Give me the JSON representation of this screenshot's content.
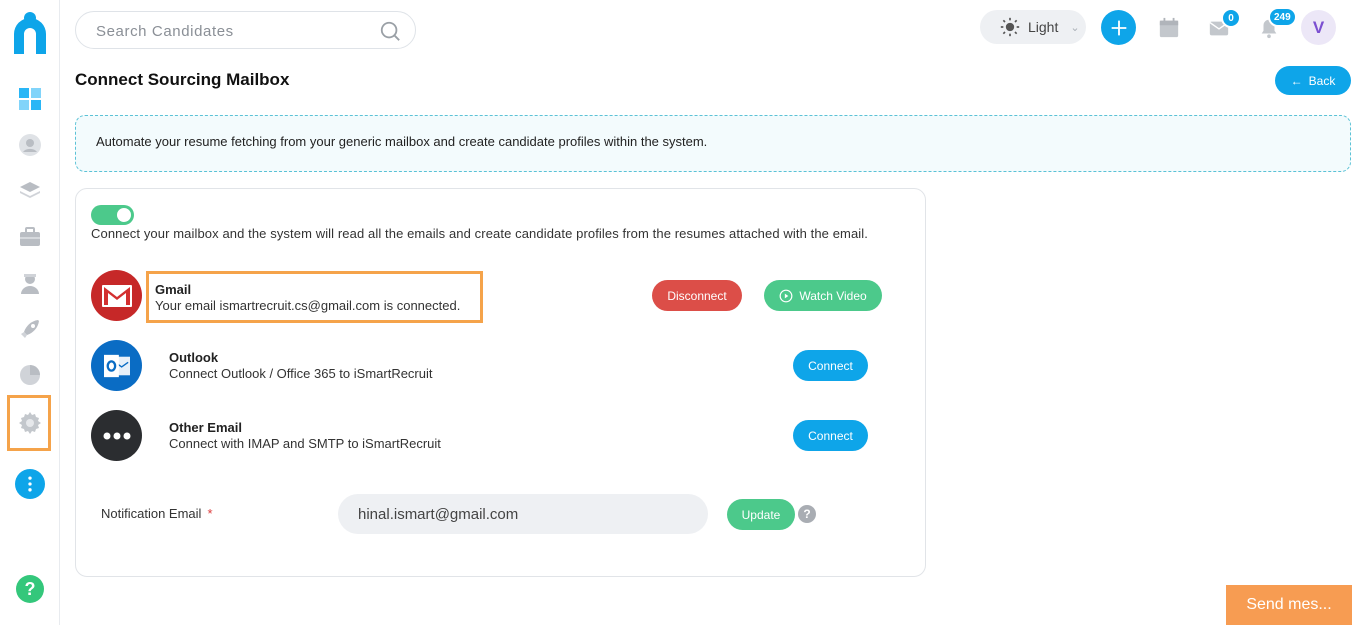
{
  "search": {
    "placeholder": "Search Candidates"
  },
  "header": {
    "theme_label": "Light",
    "mail_count": "0",
    "notification_count": "249",
    "avatar_initial": "V"
  },
  "page": {
    "title": "Connect Sourcing Mailbox",
    "back_label": "Back",
    "info_text": "Automate your resume fetching from your generic mailbox and create candidate profiles within the system."
  },
  "card": {
    "description": "Connect your mailbox and the system will read all the emails and create candidate profiles from the resumes attached with the email.",
    "providers": [
      {
        "name": "Gmail",
        "subtitle": "Your email ismartrecruit.cs@gmail.com is connected.",
        "icon": "gmail-icon"
      },
      {
        "name": "Outlook",
        "subtitle": "Connect Outlook / Office 365 to iSmartRecruit",
        "icon": "outlook-icon"
      },
      {
        "name": "Other Email",
        "subtitle": "Connect with IMAP and SMTP to iSmartRecruit",
        "icon": "more-horizontal-icon"
      }
    ],
    "disconnect_label": "Disconnect",
    "watch_video_label": "Watch Video",
    "connect_label": "Connect",
    "notification_label": "Notification Email",
    "required_mark": "*",
    "notification_value": "hinal.ismart@gmail.com",
    "update_label": "Update",
    "help_mark": "?"
  },
  "sidebar": {
    "help_mark": "?"
  },
  "chat": {
    "label": "Send mes..."
  },
  "colors": {
    "primary": "#0ea5e9",
    "success": "#4cc98b",
    "danger": "#dc4e48",
    "highlight": "#f5a34a"
  }
}
